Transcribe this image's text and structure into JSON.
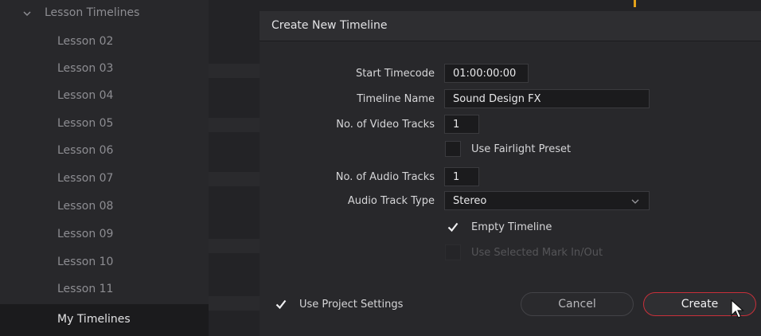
{
  "sidebar": {
    "group": {
      "label": "Lesson Timelines",
      "icon": "chevron-down-icon"
    },
    "items": [
      {
        "label": "Lesson 02",
        "selected": false
      },
      {
        "label": "Lesson 03",
        "selected": false
      },
      {
        "label": "Lesson 04",
        "selected": false
      },
      {
        "label": "Lesson 05",
        "selected": false
      },
      {
        "label": "Lesson 06",
        "selected": false
      },
      {
        "label": "Lesson 07",
        "selected": false
      },
      {
        "label": "Lesson 08",
        "selected": false
      },
      {
        "label": "Lesson 09",
        "selected": false
      },
      {
        "label": "Lesson 10",
        "selected": false
      },
      {
        "label": "Lesson 11",
        "selected": false
      },
      {
        "label": "My Timelines",
        "selected": true
      }
    ]
  },
  "dialog": {
    "title": "Create New Timeline",
    "fields": {
      "start_timecode": {
        "label": "Start Timecode",
        "value": "01:00:00:00"
      },
      "timeline_name": {
        "label": "Timeline Name",
        "value": "Sound Design FX"
      },
      "video_tracks": {
        "label": "No. of Video Tracks",
        "value": "1"
      },
      "fairlight_preset": {
        "label": "Use Fairlight Preset",
        "checked": false
      },
      "audio_tracks": {
        "label": "No. of Audio Tracks",
        "value": "1"
      },
      "audio_track_type": {
        "label": "Audio Track Type",
        "value": "Stereo"
      },
      "empty_timeline": {
        "label": "Empty Timeline",
        "checked": true
      },
      "selected_mark": {
        "label": "Use Selected Mark In/Out",
        "checked": false,
        "disabled": true
      }
    },
    "use_project_settings": {
      "label": "Use Project Settings",
      "checked": true
    },
    "buttons": {
      "cancel": "Cancel",
      "create": "Create"
    }
  },
  "colors": {
    "accent_red": "#c8303a",
    "playhead": "#e3a21a",
    "background": "#1f1f22"
  }
}
